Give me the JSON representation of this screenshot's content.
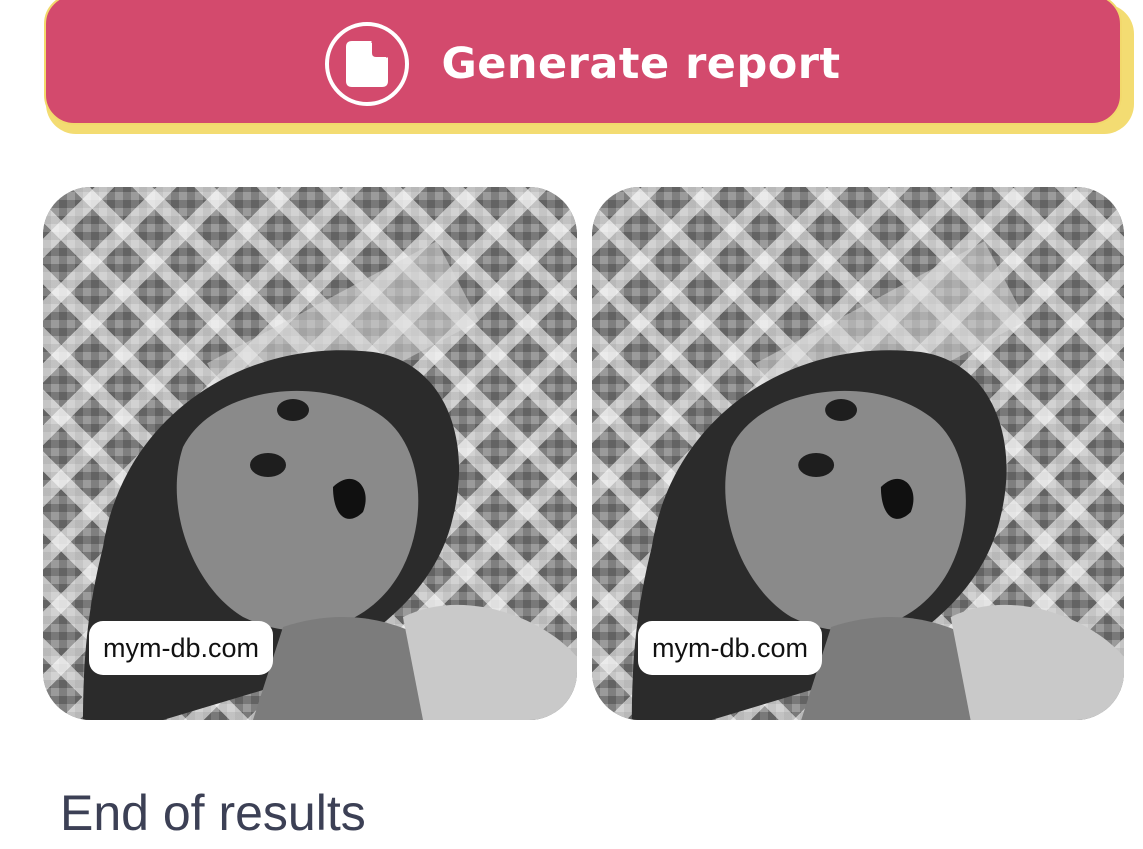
{
  "report_button": {
    "label": "Generate report",
    "icon": "document-icon",
    "colors": {
      "background": "#d34a6d",
      "shadow": "#f3dc72",
      "text": "#ffffff"
    }
  },
  "results": [
    {
      "source": "mym-db.com",
      "image": "grayscale photo of a woman tilting her head in front of a lattice fence"
    },
    {
      "source": "mym-db.com",
      "image": "grayscale photo of a woman tilting her head in front of a lattice fence"
    }
  ],
  "footer": {
    "end_text": "End of results"
  }
}
